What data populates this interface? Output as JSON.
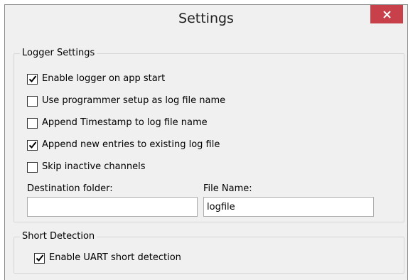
{
  "window": {
    "title": "Settings"
  },
  "logger_settings": {
    "legend": "Logger Settings",
    "options": [
      {
        "label": "Enable logger on app start",
        "checked": true
      },
      {
        "label": "Use programmer setup as log file name",
        "checked": false
      },
      {
        "label": "Append Timestamp to log file name",
        "checked": false
      },
      {
        "label": "Append new entries to existing log file",
        "checked": true
      },
      {
        "label": "Skip inactive channels",
        "checked": false
      }
    ],
    "destination_folder": {
      "label": "Destination folder:",
      "value": ""
    },
    "file_name": {
      "label": "File Name:",
      "value": "logfile"
    }
  },
  "short_detection": {
    "legend": "Short Detection",
    "options": [
      {
        "label": "Enable UART short detection",
        "checked": true
      }
    ]
  },
  "colors": {
    "close_button": "#c7404a",
    "window_bg": "#f0f0f0",
    "group_border": "#d6d6d6"
  }
}
